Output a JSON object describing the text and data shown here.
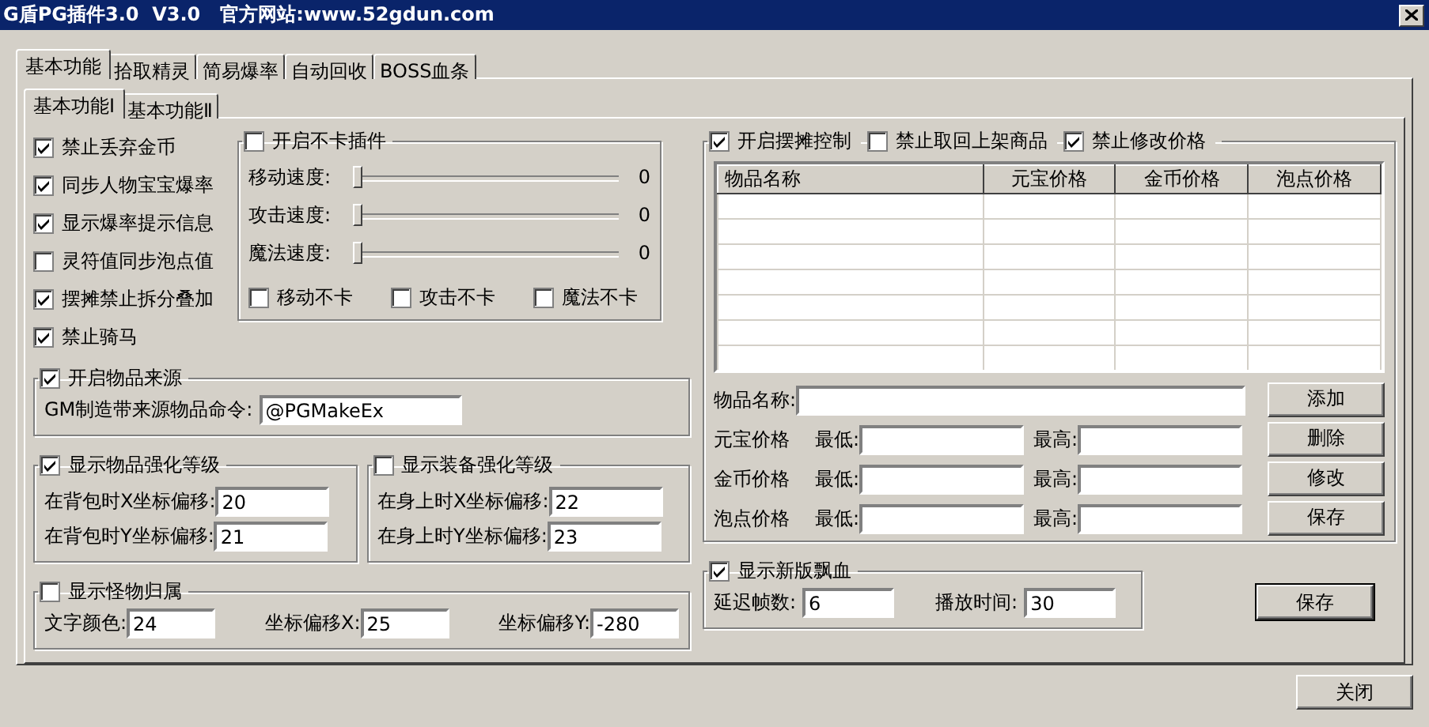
{
  "window": {
    "title": "G盾PG插件3.0  V3.0   官方网站:www.52gdun.com"
  },
  "tabs": [
    {
      "label": "基本功能",
      "selected": true
    },
    {
      "label": "拾取精灵",
      "selected": false
    },
    {
      "label": "简易爆率",
      "selected": false
    },
    {
      "label": "自动回收",
      "selected": false
    },
    {
      "label": "BOSS血条",
      "selected": false
    }
  ],
  "subtabs": [
    {
      "label": "基本功能Ⅰ",
      "selected": true
    },
    {
      "label": "基本功能Ⅱ",
      "selected": false
    }
  ],
  "options": [
    {
      "label": "禁止丢弃金币",
      "checked": true
    },
    {
      "label": "同步人物宝宝爆率",
      "checked": true
    },
    {
      "label": "显示爆率提示信息",
      "checked": true
    },
    {
      "label": "灵符值同步泡点值",
      "checked": false
    },
    {
      "label": "摆摊禁止拆分叠加",
      "checked": true
    },
    {
      "label": "禁止骑马",
      "checked": true
    }
  ],
  "nolag_group": {
    "label": "开启不卡插件",
    "checked": false,
    "sliders": [
      {
        "label": "移动速度:",
        "level": 0,
        "reading": "0"
      },
      {
        "label": "攻击速度:",
        "level": 0,
        "reading": "0"
      },
      {
        "label": "魔法速度:",
        "level": 0,
        "reading": "0"
      }
    ],
    "toggles": [
      {
        "label": "移动不卡",
        "checked": false
      },
      {
        "label": "攻击不卡",
        "checked": false
      },
      {
        "label": "魔法不卡",
        "checked": false
      }
    ]
  },
  "item_source": {
    "label": "开启物品来源",
    "checked": true,
    "field_label": "GM制造带来源物品命令:",
    "value": "@PGMakeEx"
  },
  "bag_level": {
    "label": "显示物品强化等级",
    "checked": true,
    "fields": [
      {
        "label": "在背包时X坐标偏移:",
        "value": "20"
      },
      {
        "label": "在背包时Y坐标偏移:",
        "value": "21"
      }
    ]
  },
  "equip_level": {
    "label": "显示装备强化等级",
    "checked": false,
    "fields": [
      {
        "label": "在身上时X坐标偏移:",
        "value": "22"
      },
      {
        "label": "在身上时Y坐标偏移:",
        "value": "23"
      }
    ]
  },
  "monster_owner": {
    "label": "显示怪物归属",
    "checked": false,
    "fields": [
      {
        "label": "文字颜色:",
        "value": "24"
      },
      {
        "label": "坐标偏移X:",
        "value": "25"
      },
      {
        "label": "坐标偏移Y:",
        "value": "-280"
      }
    ]
  },
  "stall": {
    "toggles": [
      {
        "label": "开启摆摊控制",
        "checked": true
      },
      {
        "label": "禁止取回上架商品",
        "checked": false
      },
      {
        "label": "禁止修改价格",
        "checked": true
      }
    ],
    "table": {
      "columns": [
        "物品名称",
        "元宝价格",
        "金币价格",
        "泡点价格"
      ]
    },
    "name_label": "物品名称:",
    "price_rows": [
      {
        "label": "元宝价格",
        "min_label": "最低:",
        "max_label": "最高:"
      },
      {
        "label": "金币价格",
        "min_label": "最低:",
        "max_label": "最高:"
      },
      {
        "label": "泡点价格",
        "min_label": "最低:",
        "max_label": "最高:"
      }
    ],
    "buttons": [
      "添加",
      "删除",
      "修改",
      "保存"
    ]
  },
  "floating_blood": {
    "label": "显示新版飘血",
    "checked": true,
    "fields": [
      {
        "label": "延迟帧数:",
        "value": "6"
      },
      {
        "label": "播放时间:",
        "value": "30"
      }
    ]
  },
  "save_button": "保存",
  "close_button": "关闭"
}
